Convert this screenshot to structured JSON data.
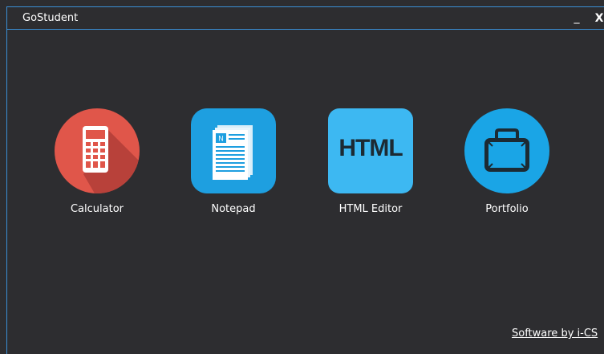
{
  "window": {
    "title": "GoStudent",
    "minimize_label": "_",
    "close_label": "X"
  },
  "apps": [
    {
      "label": "Calculator",
      "icon": "calculator-icon",
      "color": "#e0564a"
    },
    {
      "label": "Notepad",
      "icon": "notepad-icon",
      "color": "#1e9fe0"
    },
    {
      "label": "HTML Editor",
      "icon": "html-icon",
      "icon_text": "HTML",
      "color": "#3db8f2"
    },
    {
      "label": "Portfolio",
      "icon": "portfolio-icon",
      "color": "#1aa5e6"
    }
  ],
  "footer": {
    "link_text": "Software by i-CS"
  },
  "colors": {
    "background": "#2d2d30",
    "accent_border": "#3a8fd6"
  }
}
